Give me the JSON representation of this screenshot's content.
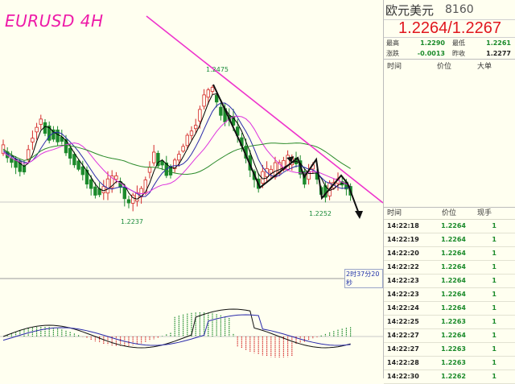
{
  "chart": {
    "title": "EURUSD 4H",
    "high_label": "1.2475",
    "low_label_1": "1.2237",
    "low_label_2": "1.2252",
    "countdown": "2时37分20秒",
    "colors": {
      "up": "#d42a2a",
      "down": "#1c8a2c",
      "trendline": "#ee33cc",
      "ma_short": "#000000",
      "ma_mid": "#2a2aaa",
      "ma_long": "#dd33dd",
      "ma_slow": "#2a8a2a"
    }
  },
  "quote": {
    "name": "欧元美元",
    "code": "8160",
    "bid_ask": "1.2264/1.2267",
    "stats": [
      {
        "l1": "最高",
        "v1": "1.2290",
        "l2": "最低",
        "v2": "1.2261"
      },
      {
        "l1": "涨跌",
        "v1": "-0.0013",
        "l2": "昨收",
        "v2": "1.2277"
      }
    ],
    "table_head": {
      "c1": "时间",
      "c2": "价位",
      "c3": "大单"
    },
    "tick_head": {
      "c1": "时间",
      "c2": "价位",
      "c3": "现手"
    },
    "ticks": [
      {
        "time": "14:22:18",
        "price": "1.2264",
        "vol": "1"
      },
      {
        "time": "14:22:19",
        "price": "1.2264",
        "vol": "1"
      },
      {
        "time": "14:22:20",
        "price": "1.2264",
        "vol": "1"
      },
      {
        "time": "14:22:22",
        "price": "1.2264",
        "vol": "1"
      },
      {
        "time": "14:22:23",
        "price": "1.2264",
        "vol": "1"
      },
      {
        "time": "14:22:23",
        "price": "1.2264",
        "vol": "1"
      },
      {
        "time": "14:22:24",
        "price": "1.2264",
        "vol": "1"
      },
      {
        "time": "14:22:25",
        "price": "1.2263",
        "vol": "1"
      },
      {
        "time": "14:22:27",
        "price": "1.2264",
        "vol": "1"
      },
      {
        "time": "14:22:27",
        "price": "1.2263",
        "vol": "1"
      },
      {
        "time": "14:22:28",
        "price": "1.2263",
        "vol": "1"
      },
      {
        "time": "14:22:30",
        "price": "1.2262",
        "vol": "1"
      }
    ]
  }
}
